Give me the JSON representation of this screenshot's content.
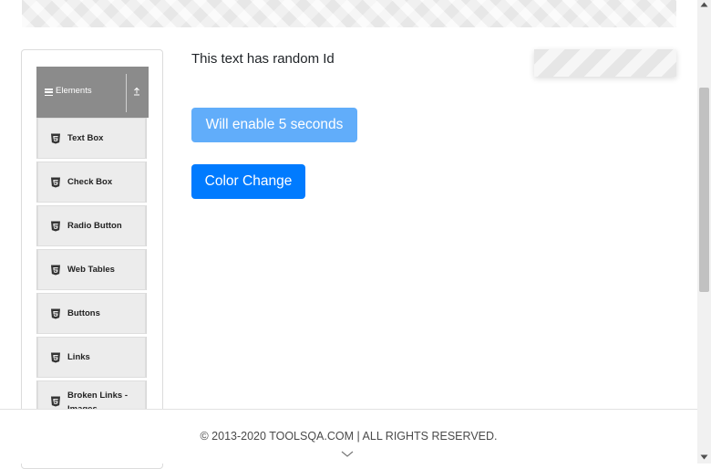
{
  "sidebar": {
    "group_title": "Elements",
    "items": [
      {
        "label": "Text Box"
      },
      {
        "label": "Check Box"
      },
      {
        "label": "Radio Button"
      },
      {
        "label": "Web Tables"
      },
      {
        "label": "Buttons"
      },
      {
        "label": "Links"
      },
      {
        "label": "Broken Links - Images"
      }
    ]
  },
  "main": {
    "random_text": "This text has random Id",
    "enable_button_label": "Will enable 5 seconds",
    "color_button_label": "Color Change"
  },
  "footer": {
    "copyright": "© 2013-2020 TOOLSQA.COM | ALL RIGHTS RESERVED."
  },
  "colors": {
    "primary_button": "#007bff",
    "disabled_button": "#61adfa",
    "group_header": "#8b8b8b"
  }
}
